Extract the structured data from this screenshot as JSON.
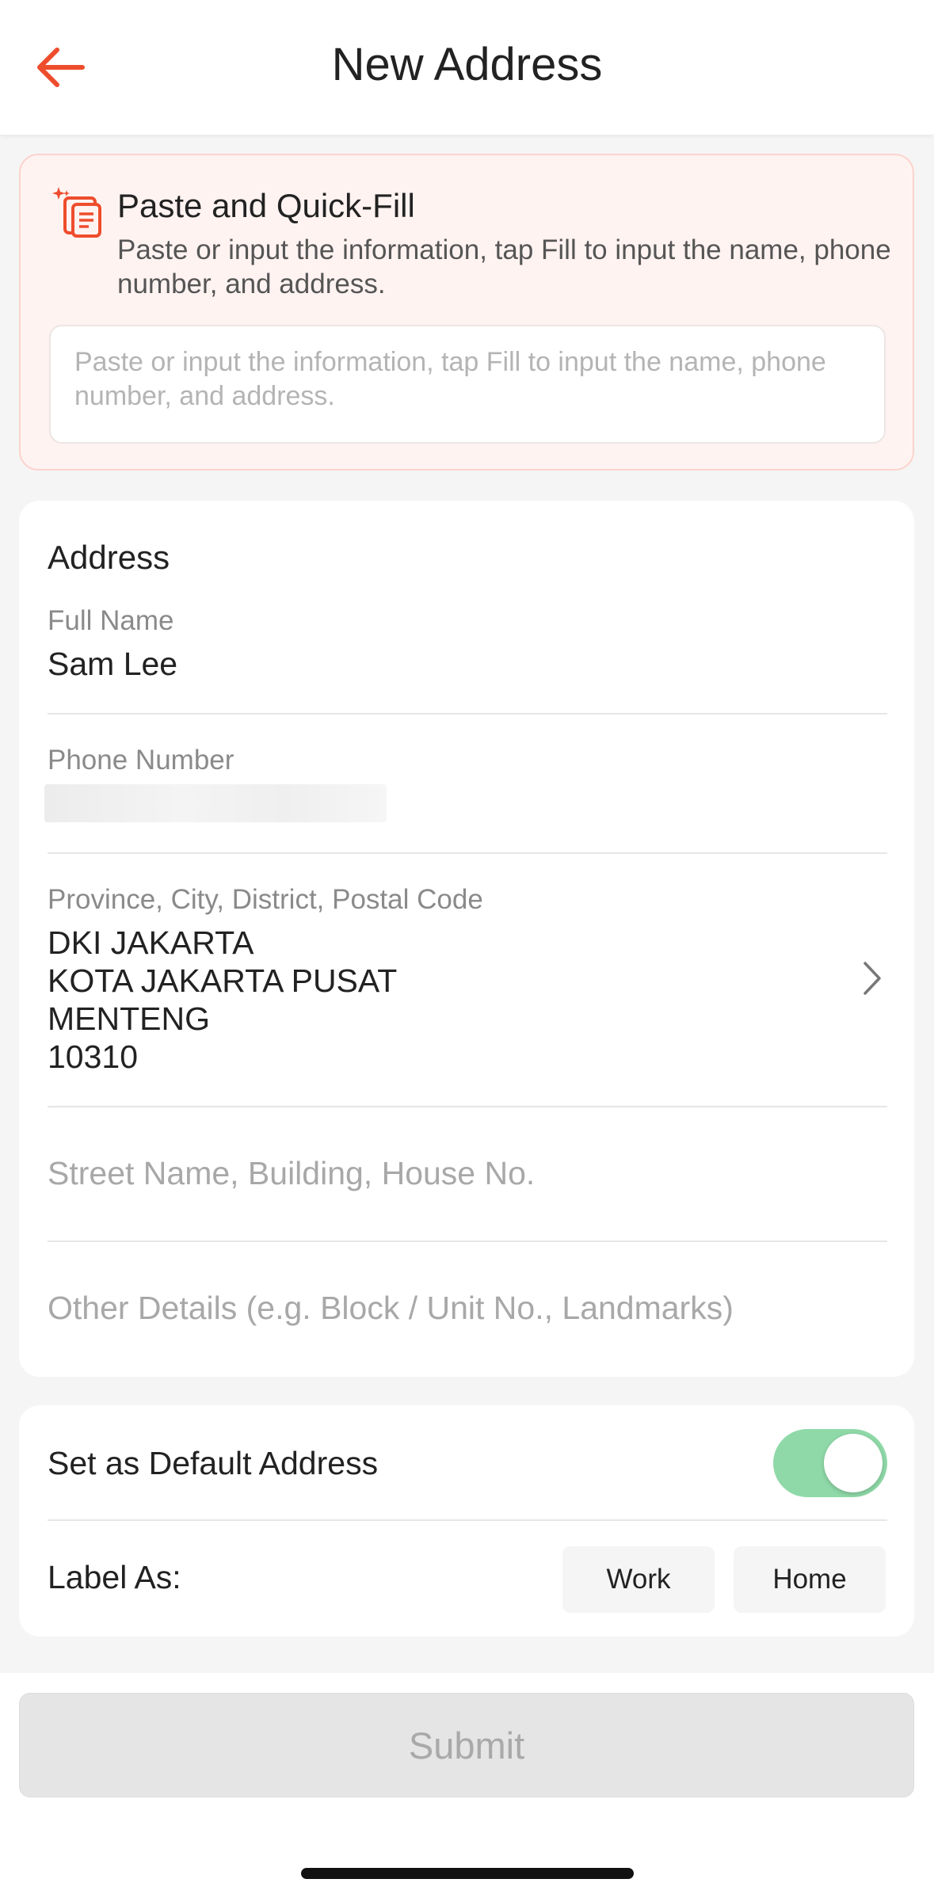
{
  "header": {
    "title": "New Address"
  },
  "quick_fill": {
    "title": "Paste and Quick-Fill",
    "description": "Paste or input the information, tap Fill to input the name, phone number, and address.",
    "placeholder": "Paste or input the information, tap Fill to input the name, phone number, and address."
  },
  "address": {
    "section_title": "Address",
    "full_name_label": "Full Name",
    "full_name_value": "Sam Lee",
    "phone_label": "Phone Number",
    "region_label": "Province, City, District, Postal Code",
    "region_lines": [
      "DKI JAKARTA",
      "KOTA JAKARTA PUSAT",
      "MENTENG",
      "10310"
    ],
    "street_placeholder": "Street Name, Building, House No.",
    "other_placeholder": "Other Details (e.g. Block / Unit No., Landmarks)"
  },
  "settings": {
    "default_label": "Set as Default Address",
    "default_on": true,
    "label_as": "Label As:",
    "work_label": "Work",
    "home_label": "Home"
  },
  "footer": {
    "submit_label": "Submit"
  },
  "colors": {
    "accent": "#ee4d2d",
    "toggle_on": "#8fd9a8"
  }
}
